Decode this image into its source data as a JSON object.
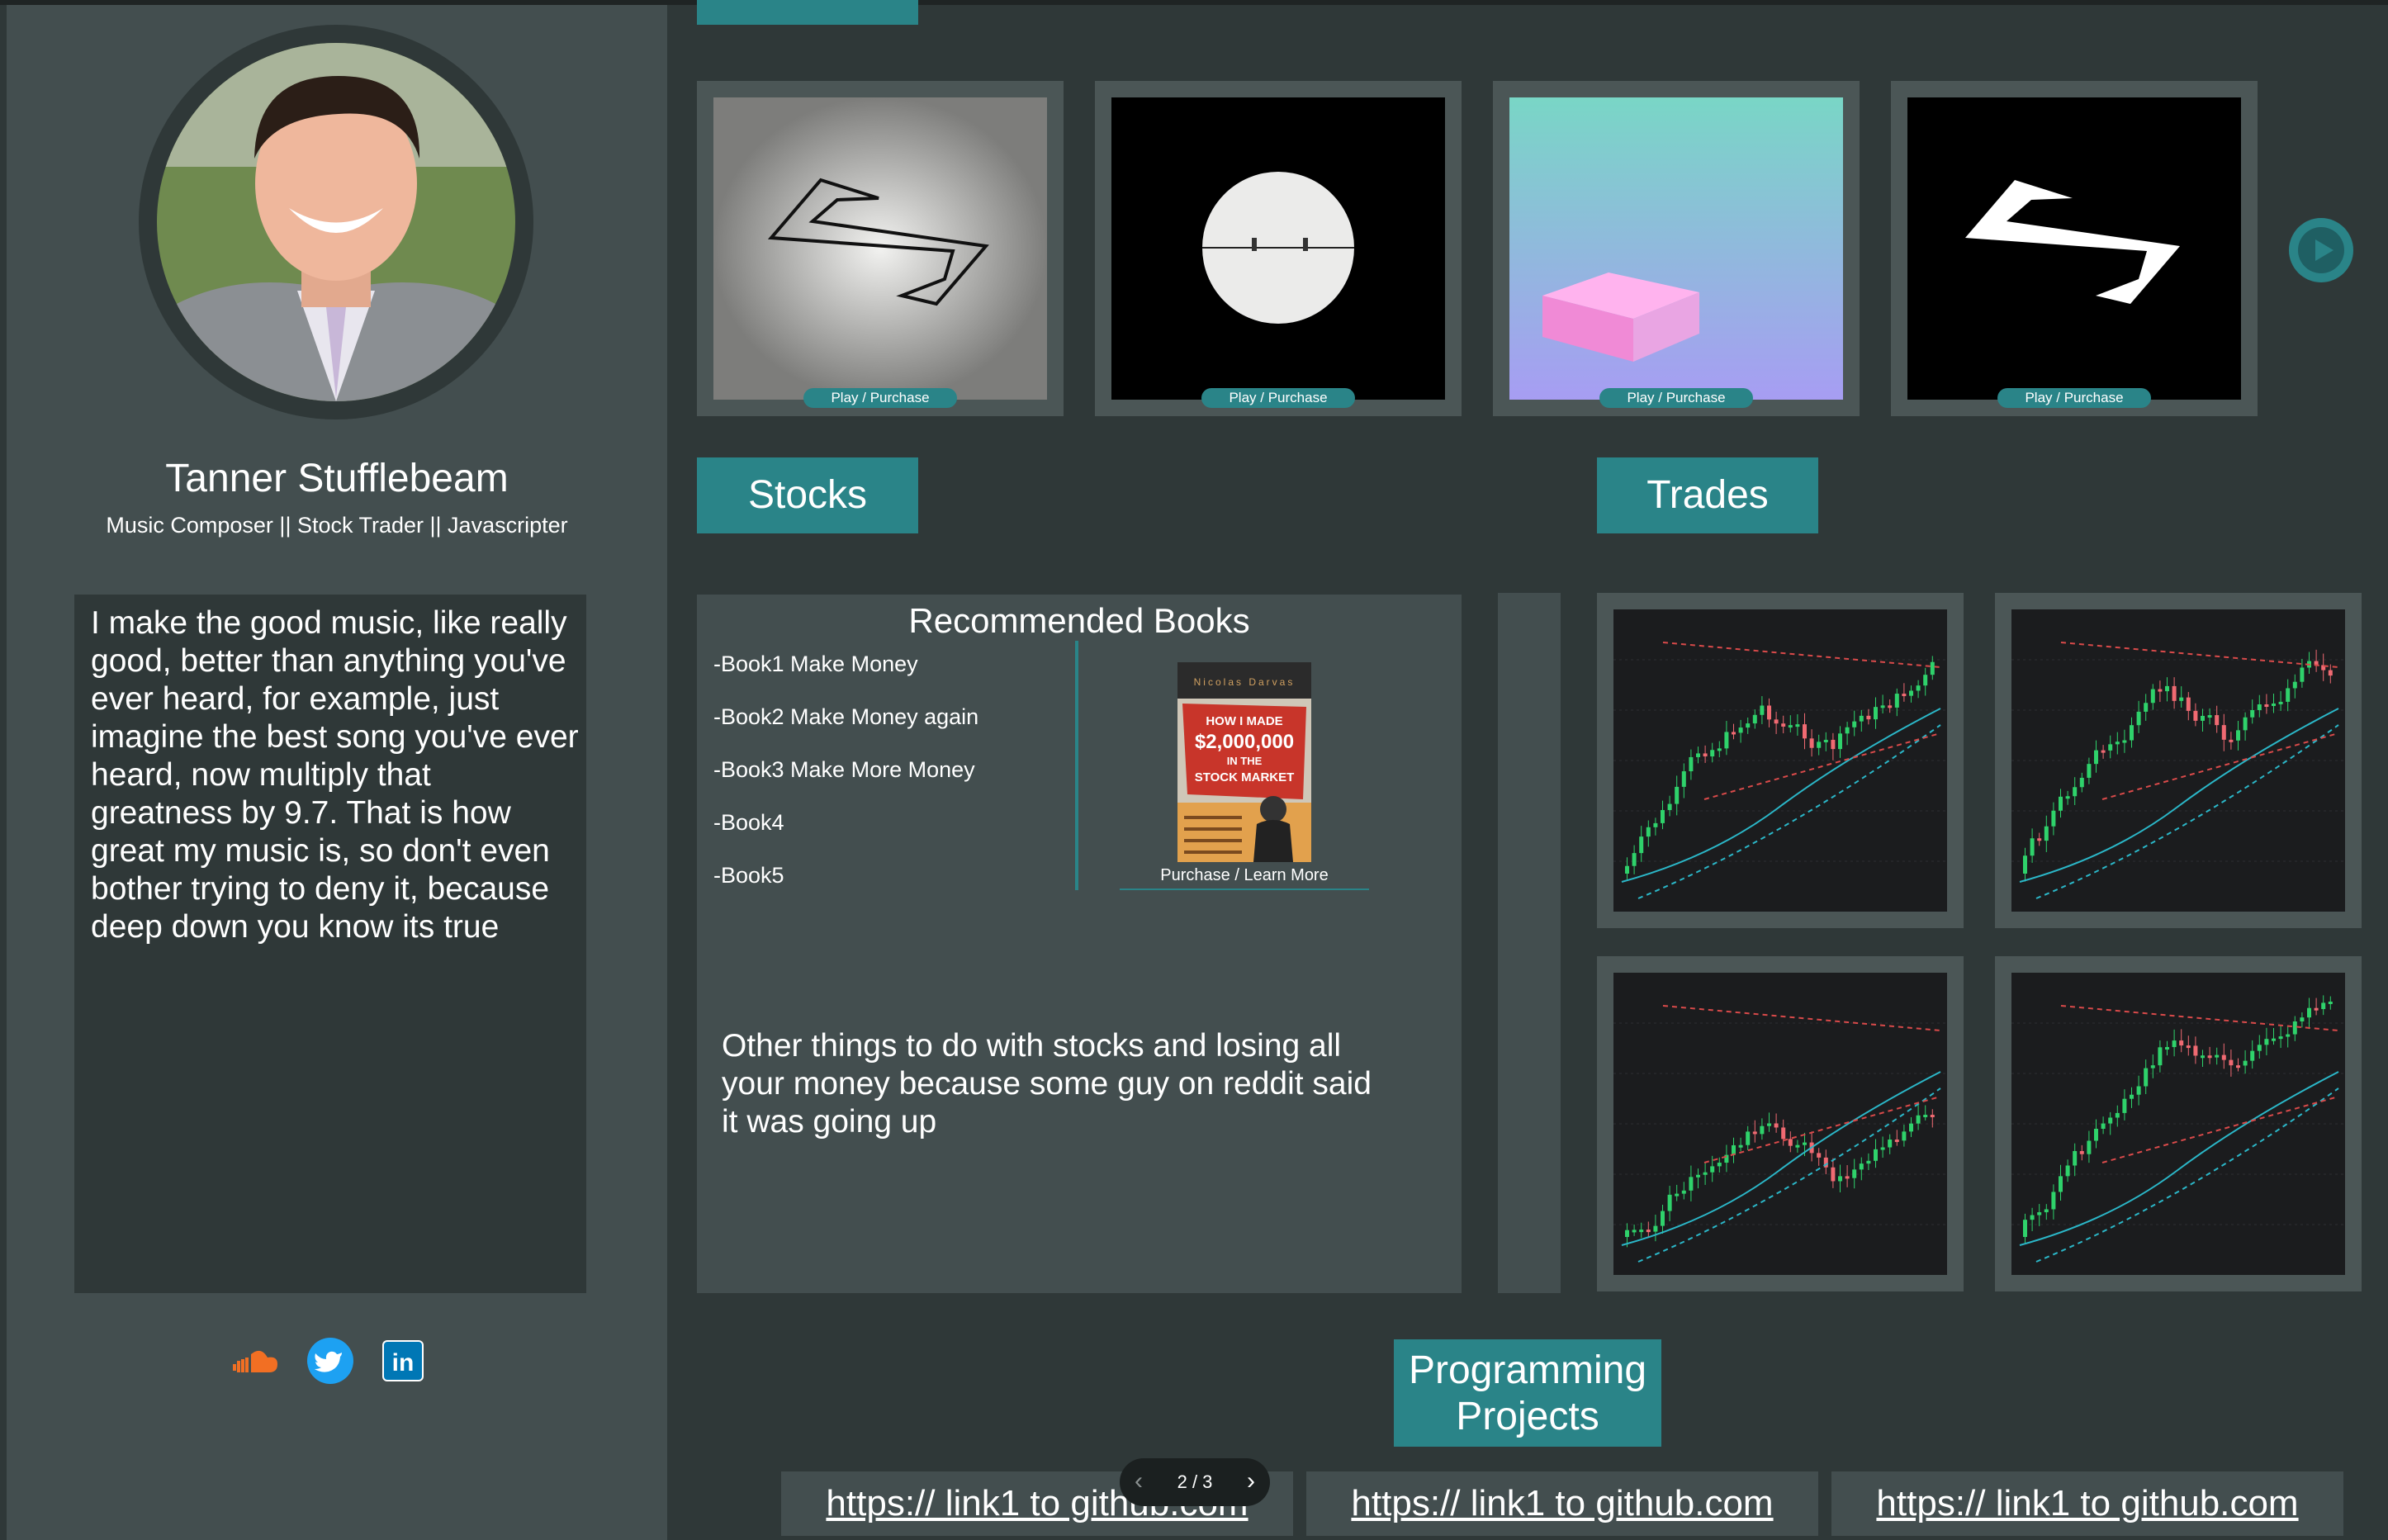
{
  "profile": {
    "name": "Tanner Stufflebeam",
    "tagline": "Music Composer || Stock Trader || Javascripter",
    "bio": "I make the good music, like really\ngood, better than anything you've\never heard, for example, just\nimagine the best song you've ever\nheard, now multiply that\ngreatness by 9.7. That is how\ngreat my music is,  so don't even\nbother trying to deny it, because\ndeep down you know its true"
  },
  "social": [
    {
      "name": "soundcloud-icon"
    },
    {
      "name": "twitter-icon"
    },
    {
      "name": "linkedin-icon",
      "label": "in"
    }
  ],
  "music": {
    "tracks": [
      {
        "action": "Play / Purchase"
      },
      {
        "action": "Play / Purchase"
      },
      {
        "action": "Play / Purchase"
      },
      {
        "action": "Play / Purchase"
      }
    ]
  },
  "sections": {
    "stocks": "Stocks",
    "trades": "Trades",
    "projects_line1": "Programming",
    "projects_line2": "Projects"
  },
  "books": {
    "title": "Recommended Books",
    "items": [
      "-Book1  Make Money",
      "-Book2 Make Money again",
      "-Book3 Make More Money",
      "-Book4",
      "-Book5"
    ],
    "featured": {
      "author": "Nicolas Darvas",
      "title_line1": "HOW I MADE",
      "title_line2": "$2,000,000",
      "title_line3": "IN THE",
      "title_line4": "STOCK MARKET",
      "link": "Purchase / Learn More"
    }
  },
  "stocks_note": "Other things to do with stocks and losing all\nyour money because some guy on reddit said\nit was going up",
  "links": [
    "https:// link1 to github.com",
    "https:// link1 to github.com",
    "https:// link1 to github.com"
  ],
  "pager": {
    "label": "2 / 3",
    "prev": "‹",
    "next": "›"
  },
  "colors": {
    "accent": "#2a8488",
    "panel": "#434e4f",
    "background": "#2f3838"
  }
}
